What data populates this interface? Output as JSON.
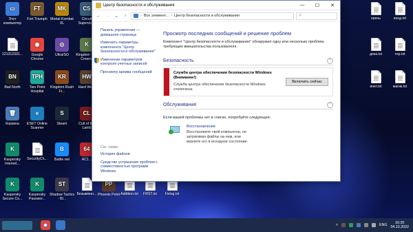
{
  "desktop": {
    "left_icons": [
      {
        "label": "Этот компьютер",
        "name": "this-pc",
        "icon": "monitor-icon",
        "color": "#3d7bd8",
        "glyph": "▭"
      },
      {
        "label": "Fort Triumph",
        "name": "fort-triumph",
        "icon": "game-icon",
        "color": "#7a5a2e",
        "glyph": "FT"
      },
      {
        "label": "Mortal Kombat XL",
        "name": "mortal-kombat-xl",
        "icon": "game-icon",
        "color": "#b8860b",
        "glyph": "MK"
      },
      {
        "label": "Circuit Superstars",
        "name": "circuit-superstars",
        "icon": "game-icon",
        "color": "#3a5f7a",
        "glyph": "CS"
      },
      {
        "label": "121312331...",
        "name": "file-121312331",
        "icon": "file-icon",
        "color": "#ffffff",
        "glyph": ""
      },
      {
        "label": "Google Chrome",
        "name": "google-chrome",
        "icon": "chrome-icon",
        "color": "#e8453c",
        "glyph": "◉"
      },
      {
        "label": "UltraISO",
        "name": "ultraiso",
        "icon": "disc-icon",
        "color": "#6b4aa8",
        "glyph": "◎"
      },
      {
        "label": "Kingdom Two Crowns",
        "name": "kingdom-two-crowns",
        "icon": "game-icon",
        "color": "#5a7a4a",
        "glyph": "K"
      },
      {
        "label": "Bad North",
        "name": "bad-north",
        "icon": "game-icon",
        "color": "#202020",
        "glyph": "BN"
      },
      {
        "label": "Two Point Hospital",
        "name": "two-point-hospital",
        "icon": "game-icon",
        "color": "#1fa89a",
        "glyph": "TPH"
      },
      {
        "label": "Kingdom Rush Fr...",
        "name": "kingdom-rush",
        "icon": "game-icon",
        "color": "#8a4a1a",
        "glyph": "KR"
      },
      {
        "label": "Hard West",
        "name": "hard-west",
        "icon": "game-icon",
        "color": "#5a4030",
        "glyph": "HW"
      },
      {
        "label": "Корзина",
        "name": "recycle-bin",
        "icon": "recycle-bin-icon",
        "color": "#4a7ab8",
        "glyph": "🗑"
      },
      {
        "label": "ESET Online Scanner",
        "name": "eset-online-scanner",
        "icon": "eset-icon",
        "color": "#1b7fc0",
        "glyph": "e"
      },
      {
        "label": "Steam",
        "name": "steam",
        "icon": "steam-icon",
        "color": "#1b2838",
        "glyph": "S"
      },
      {
        "label": "Cult of the Lamb",
        "name": "cult-of-the-lamb",
        "icon": "game-icon",
        "color": "#7a1a1a",
        "glyph": "CL"
      },
      {
        "label": "Kaspersky Internet...",
        "name": "kaspersky-internet",
        "icon": "kaspersky-icon",
        "color": "#0f8a6a",
        "glyph": "K"
      },
      {
        "label": "SecurityCh...",
        "name": "security-check",
        "icon": "file-icon",
        "color": "#ffffff",
        "glyph": ""
      },
      {
        "label": "Battle.net",
        "name": "battle-net",
        "icon": "battlenet-icon",
        "color": "#148eff",
        "glyph": "B"
      },
      {
        "label": "AC1...",
        "name": "ac-game",
        "icon": "game-icon",
        "color": "#c0282e",
        "glyph": "64"
      },
      {
        "label": "Kaspersky Secure Co...",
        "name": "kaspersky-secure",
        "icon": "kaspersky-icon",
        "color": "#0f8a6a",
        "glyph": "K"
      },
      {
        "label": "Kaspersky Passwor...",
        "name": "kaspersky-password",
        "icon": "kaspersky-icon",
        "color": "#0f8a6a",
        "glyph": "K"
      },
      {
        "label": "Shadow Tactics - Bl...",
        "name": "shadow-tactics",
        "icon": "game-icon",
        "color": "#3a3a4a",
        "glyph": "ST"
      },
      {
        "label": "Безымянн...",
        "name": "unnamed-file",
        "icon": "file-icon",
        "color": "#ffffff",
        "glyph": ""
      },
      {
        "label": "Phoenix Point",
        "name": "phoenix-point",
        "icon": "game-icon",
        "color": "#5a3a2a",
        "glyph": "PP"
      },
      {
        "label": "Addition.txt",
        "name": "addition-txt",
        "icon": "file-icon",
        "color": "#ffffff",
        "glyph": ""
      },
      {
        "label": "FRST.txt",
        "name": "frst-txt",
        "icon": "file-icon",
        "color": "#ffffff",
        "glyph": ""
      },
      {
        "label": "Fixlog.txt",
        "name": "fixlog-txt",
        "icon": "file-icon",
        "color": "#ffffff",
        "glyph": ""
      }
    ],
    "right_icons": [
      {
        "label": "хрень",
        "name": "khren",
        "icon": "file-icon"
      },
      {
        "label": "вход.txt",
        "name": "vkhod-txt",
        "icon": "file-icon"
      },
      {
        "label": "дека.txt",
        "name": "deka-txt",
        "icon": "file-icon"
      },
      {
        "label": "тер.txt",
        "name": "ter-txt",
        "icon": "file-icon"
      },
      {
        "label": "инет.txt",
        "name": "inet-txt",
        "icon": "file-icon"
      },
      {
        "label": "магик.txt",
        "name": "magik-txt",
        "icon": "file-icon"
      }
    ]
  },
  "window": {
    "title": "Центр безопасности и обслуживания",
    "controls": {
      "minimize": "—",
      "maximize": "☐",
      "close": "✕"
    },
    "nav": {
      "back": "←",
      "forward": "→",
      "dropdown": "⌄",
      "up": "↑"
    },
    "path": [
      "Все элемент...",
      "Центр безопасности и обслуживания"
    ],
    "path_sep": "›",
    "search_icon": "⌕",
    "sidebar": {
      "links": [
        "Панель управления — домашняя страница",
        "Изменить параметры компонента \"Центр безопасности и обслуживания\""
      ],
      "shield_link": "Изменение параметров контроля учетных записей",
      "archive_link": "Просмотр архива сообщений",
      "see_also_header": "См. также",
      "see_also": [
        "История файлов",
        "Средство устранения проблем с совместимостью программ Windows"
      ]
    },
    "main": {
      "heading": "Просмотр последних сообщений и решение проблем",
      "intro": "Компонент \"Центр безопасности и обслуживания\" обнаружил одну или несколько проблем, требующих вмешательства пользователя.",
      "security_section": "Безопасность",
      "alert": {
        "title": "Служба центра обеспечения безопасности Windows (Внимание!)",
        "description": "Служба центра обеспечения безопасности Windows отключена.",
        "button": "Включить сейчас",
        "accent": "#c1121f"
      },
      "maintenance_section": "Обслуживание",
      "chevron": "⌃",
      "hint": "Если вашей проблемы нет в списке, попробуйте следующее:",
      "recovery": {
        "link": "Восстановление",
        "description": "Восстановите свой компьютер, не затрагивая файлы на нем, или верните его в исходное состояние."
      }
    }
  },
  "taskbar": {
    "language": "ENG",
    "time": "16:20",
    "date": "04.10.2022",
    "tray_up": "˄"
  }
}
